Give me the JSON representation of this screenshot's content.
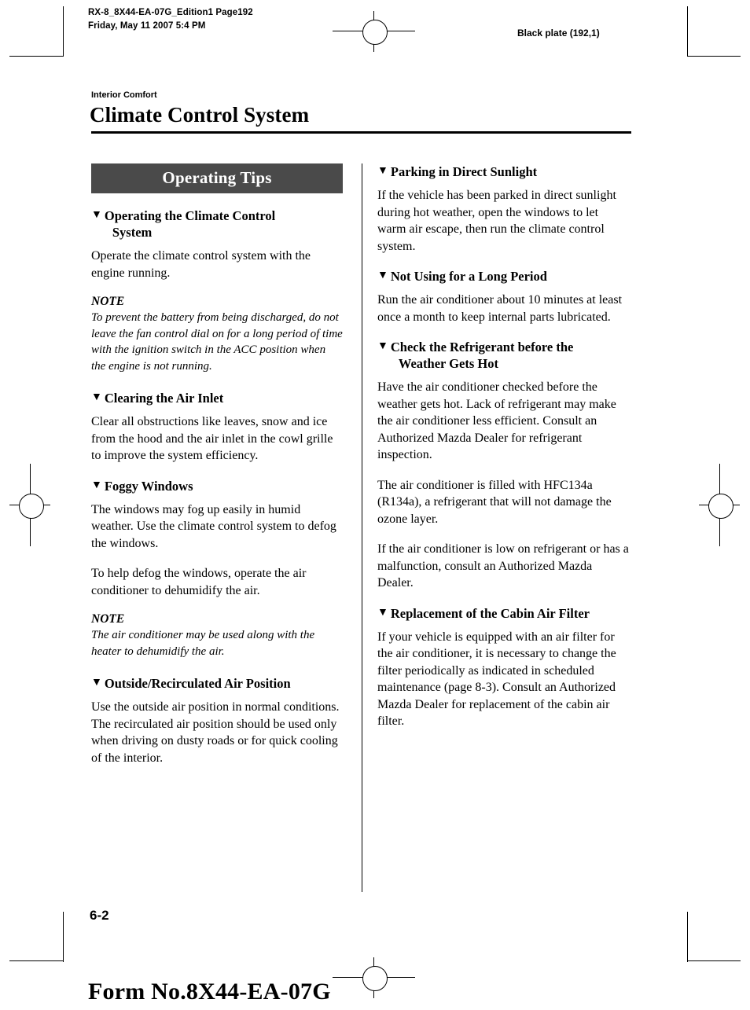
{
  "header": {
    "left_line1": "RX-8_8X44-EA-07G_Edition1 Page192",
    "left_line2": "Friday, May 11 2007 5:4 PM",
    "right": "Black plate (192,1)"
  },
  "section": {
    "eyebrow": "Interior Comfort",
    "title": "Climate Control System"
  },
  "banner": {
    "label": "Operating Tips"
  },
  "icons": {
    "triangle": "▼"
  },
  "left_column": [
    {
      "type": "subhead",
      "name": "subhead-operating-the-climate-control-system",
      "text": "Operating the Climate Control",
      "continuation": "System"
    },
    {
      "type": "body",
      "name": "body-operate-with-engine-running",
      "text": "Operate the climate control system with the engine running."
    },
    {
      "type": "note-label",
      "name": "note-label-1",
      "text": "NOTE"
    },
    {
      "type": "note-text",
      "name": "note-text-battery-discharge",
      "text": "To prevent the battery from being discharged, do not leave the fan control dial on for a long period of time with the ignition switch in the ACC position when the engine is not running."
    },
    {
      "type": "subhead",
      "name": "subhead-clearing-the-air-inlet",
      "text": "Clearing the Air Inlet"
    },
    {
      "type": "body",
      "name": "body-clear-obstructions",
      "text": "Clear all obstructions like leaves, snow and ice from the hood and the air inlet in the cowl grille to improve the system efficiency."
    },
    {
      "type": "subhead",
      "name": "subhead-foggy-windows",
      "text": "Foggy Windows"
    },
    {
      "type": "body",
      "name": "body-windows-may-fog",
      "text": "The windows may fog up easily in humid weather. Use the climate control system to defog the windows."
    },
    {
      "type": "body",
      "name": "body-help-defog",
      "text": "To help defog the windows, operate the air conditioner to dehumidify the air."
    },
    {
      "type": "note-label",
      "name": "note-label-2",
      "text": "NOTE"
    },
    {
      "type": "note-text",
      "name": "note-text-ac-with-heater",
      "text": "The air conditioner may be used along with the heater to dehumidify the air."
    },
    {
      "type": "subhead",
      "name": "subhead-outside-recirculated-air-position",
      "text": "Outside/Recirculated Air Position"
    },
    {
      "type": "body",
      "name": "body-outside-air-position",
      "text": "Use the outside air position in normal conditions. The recirculated air position should be used only when driving on dusty roads or for quick cooling of the interior."
    }
  ],
  "right_column": [
    {
      "type": "subhead",
      "name": "subhead-parking-in-direct-sunlight",
      "text": "Parking in Direct Sunlight"
    },
    {
      "type": "body",
      "name": "body-parked-in-sunlight",
      "text": "If the vehicle has been parked in direct sunlight during hot weather, open the windows to let warm air escape, then run the climate control system."
    },
    {
      "type": "subhead",
      "name": "subhead-not-using-for-a-long-period",
      "text": "Not Using for a Long Period"
    },
    {
      "type": "body",
      "name": "body-run-ac-monthly",
      "text": "Run the air conditioner about 10 minutes at least once a month to keep internal parts lubricated."
    },
    {
      "type": "subhead",
      "name": "subhead-check-the-refrigerant",
      "text": "Check the Refrigerant before the",
      "continuation": "Weather Gets Hot"
    },
    {
      "type": "body",
      "name": "body-have-ac-checked",
      "text": "Have the air conditioner checked before the weather gets hot. Lack of refrigerant may make the air conditioner less efficient. Consult an Authorized Mazda Dealer for refrigerant inspection."
    },
    {
      "type": "body",
      "name": "body-hfc134a",
      "text": "The air conditioner is filled with HFC134a (R134a), a refrigerant that will not damage the ozone layer."
    },
    {
      "type": "body",
      "name": "body-low-on-refrigerant",
      "text": "If the air conditioner is low on refrigerant or has a malfunction, consult an Authorized Mazda Dealer."
    },
    {
      "type": "subhead",
      "name": "subhead-replacement-of-the-cabin-air-filter",
      "text": "Replacement of the Cabin Air Filter"
    },
    {
      "type": "body",
      "name": "body-cabin-filter-replacement",
      "text": "If your vehicle is equipped with an air filter for the air conditioner, it is necessary to change the filter periodically as indicated in scheduled maintenance (page 8-3). Consult an Authorized Mazda Dealer for replacement of the cabin air filter."
    }
  ],
  "footer": {
    "page_number": "6-2",
    "form_number": "Form No.8X44-EA-07G"
  }
}
